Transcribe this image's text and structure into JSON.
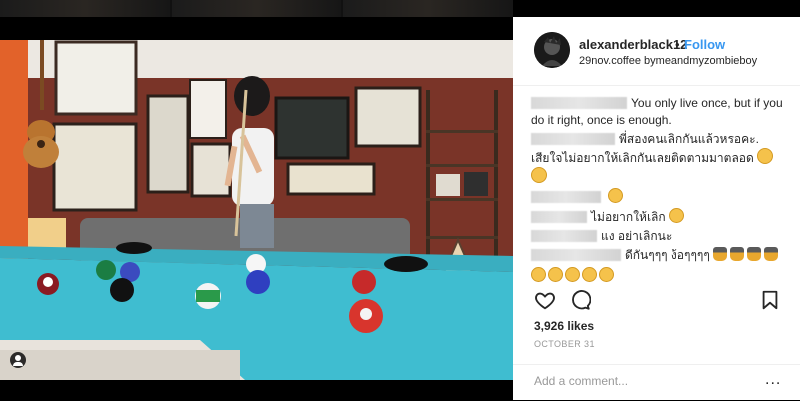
{
  "header": {
    "username": "alexanderblack12",
    "separator": "•",
    "follow_label": "Follow",
    "location": "29nov.coffee bymeandmyzombieboy"
  },
  "comments": [
    {
      "text": "You only live once, but if you do it right, once is enough.",
      "emoji_after": 0
    },
    {
      "text": "พี่สองคนเลิกกันแล้วหรอคะ. เสียใจไม่อยากให้เลิกกันเลยติดตามมาตลอด",
      "emoji_after": 2
    },
    {
      "text": "",
      "emoji_after": 1
    },
    {
      "text": "ไม่อยากให้เลิก",
      "emoji_after": 1
    },
    {
      "text": "แง อย่าเลิกนะ",
      "emoji_after": 0
    },
    {
      "text": "ดีกันๆๆๆ ง้อๆๆๆๆ",
      "emoji_after": 4
    }
  ],
  "trailing_emoji_count": 5,
  "icons": {
    "like": "heart-icon",
    "comment": "comment-icon",
    "save": "bookmark-icon",
    "more": "more-options-icon"
  },
  "stats": {
    "likes": "3,926 likes",
    "date": "OCTOBER 31"
  },
  "add_comment": {
    "placeholder": "Add a comment...",
    "more_label": "..."
  },
  "colors": {
    "follow": "#3897f0",
    "text": "#262626",
    "muted": "#999999",
    "table_felt": "#3fbdd0",
    "wall": "#7a3428"
  }
}
